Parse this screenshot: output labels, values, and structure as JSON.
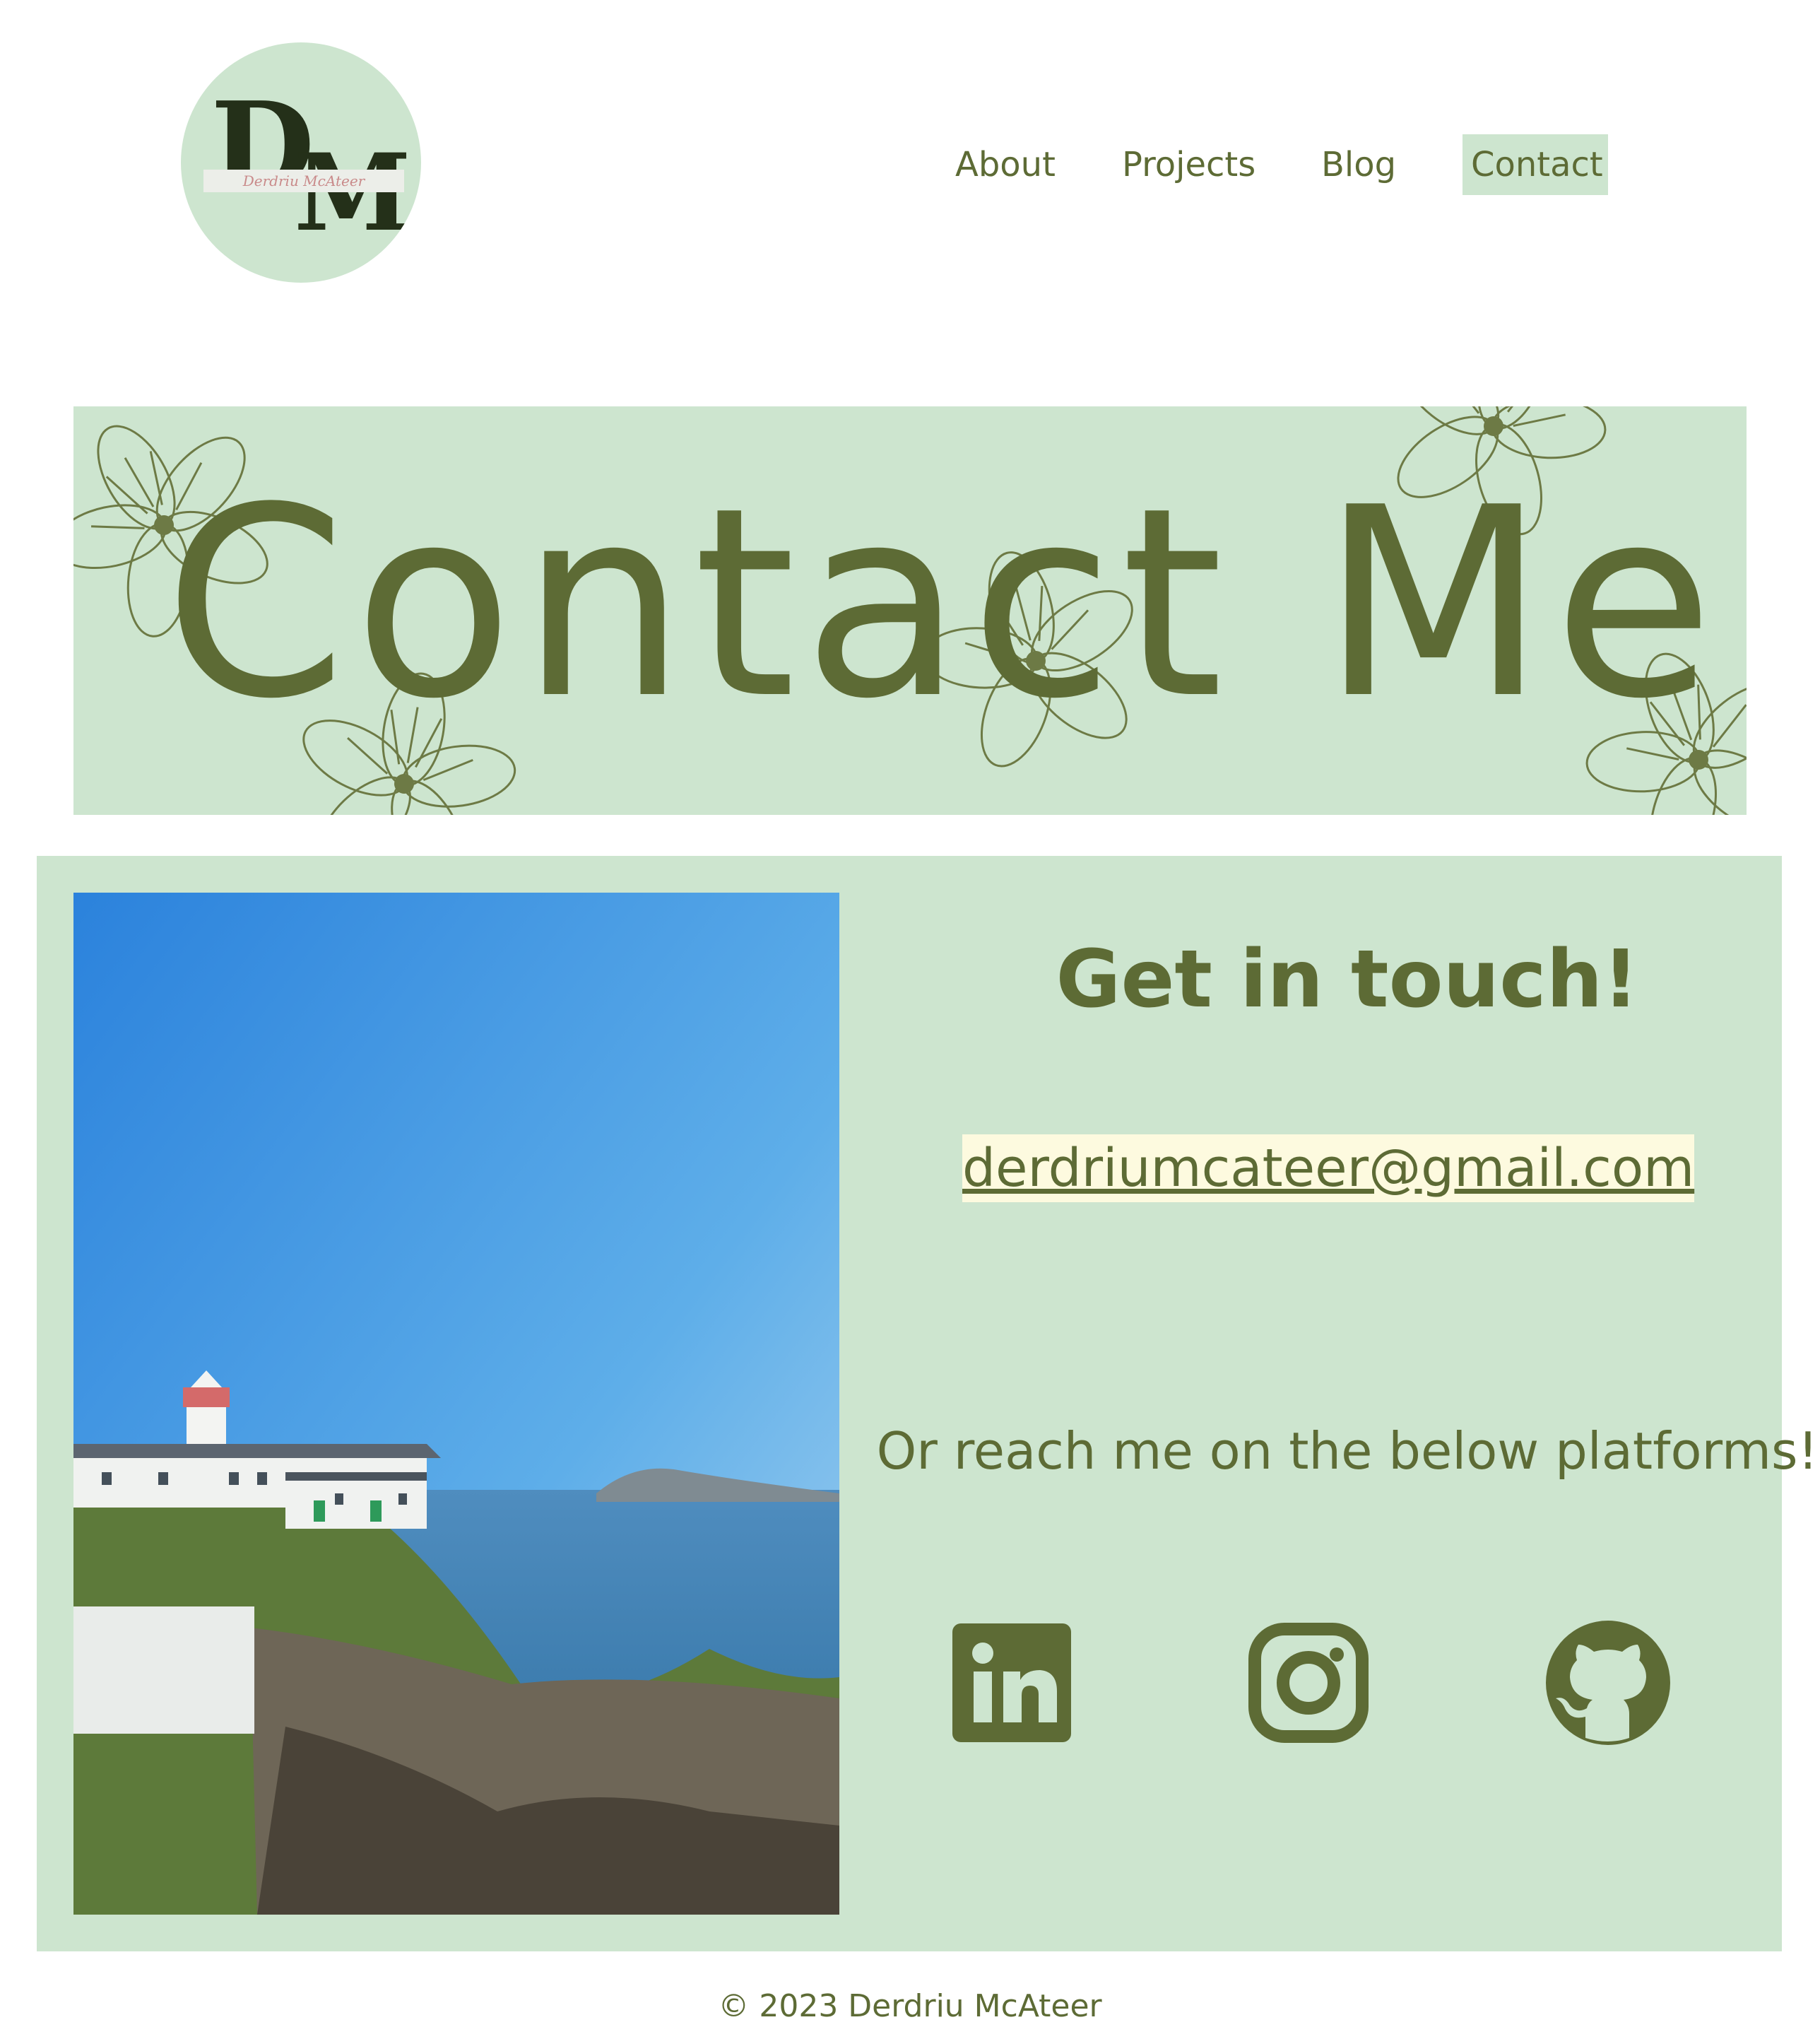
{
  "brand": {
    "monogram_first": "D",
    "monogram_second": "M",
    "signature": "Derdriu McAteer",
    "logo_background": "#cde5cf"
  },
  "nav": {
    "items": [
      {
        "label": "About"
      },
      {
        "label": "Projects"
      },
      {
        "label": "Blog"
      },
      {
        "label": "Contact",
        "active": true
      }
    ]
  },
  "banner": {
    "title": "Contact Me",
    "decoration": "flower-outline"
  },
  "contact": {
    "heading": "Get in touch!",
    "email": "derdriumcateer@gmail.com",
    "platforms_text": "Or reach me on the below platforms!",
    "photo": "lighthouse-on-cliffs",
    "socials": [
      {
        "icon": "linkedin-icon"
      },
      {
        "icon": "instagram-icon"
      },
      {
        "icon": "github-icon"
      }
    ]
  },
  "footer": {
    "text": "© 2023 Derdriu McAteer"
  },
  "colors": {
    "accent": "#5d6b35",
    "panel": "#cde5cf",
    "email_highlight": "#fdfadf",
    "background": "#ffffff"
  }
}
